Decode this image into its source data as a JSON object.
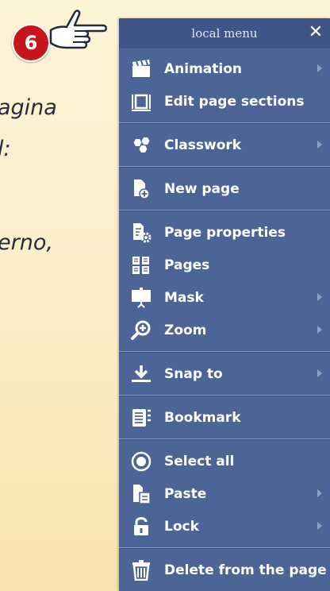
{
  "background": {
    "text_line_1": "agina",
    "text_line_2": "l:",
    "text_line_3": "erno,"
  },
  "callout": {
    "number": "6",
    "icon": "pointing-hand-icon"
  },
  "menu": {
    "title": "local menu",
    "close_label": "✕",
    "items": [
      {
        "label": "Animation",
        "icon": "clapperboard-icon",
        "has_submenu": true
      },
      {
        "label": "Edit page sections",
        "icon": "page-sections-icon",
        "has_submenu": false
      },
      {
        "label": "Classwork",
        "icon": "hexagons-icon",
        "has_submenu": true
      },
      {
        "label": "New page",
        "icon": "new-page-icon",
        "has_submenu": false
      },
      {
        "label": "Page properties",
        "icon": "page-properties-icon",
        "has_submenu": false
      },
      {
        "label": "Pages",
        "icon": "pages-grid-icon",
        "has_submenu": false
      },
      {
        "label": "Mask",
        "icon": "mask-screen-icon",
        "has_submenu": true
      },
      {
        "label": "Zoom",
        "icon": "zoom-icon",
        "has_submenu": true
      },
      {
        "label": "Snap to",
        "icon": "snap-download-icon",
        "has_submenu": true
      },
      {
        "label": "Bookmark",
        "icon": "bookmark-icon",
        "has_submenu": false
      },
      {
        "label": "Select all",
        "icon": "select-all-icon",
        "has_submenu": false
      },
      {
        "label": "Paste",
        "icon": "paste-icon",
        "has_submenu": true
      },
      {
        "label": "Lock",
        "icon": "lock-icon",
        "has_submenu": true
      },
      {
        "label": "Delete from the page",
        "icon": "trash-icon",
        "has_submenu": false
      }
    ]
  },
  "colors": {
    "menu_bg": "#4d6596",
    "header_bg": "#3f5587",
    "badge_red": "#c4161c",
    "page_bg": "#fbedc6"
  }
}
